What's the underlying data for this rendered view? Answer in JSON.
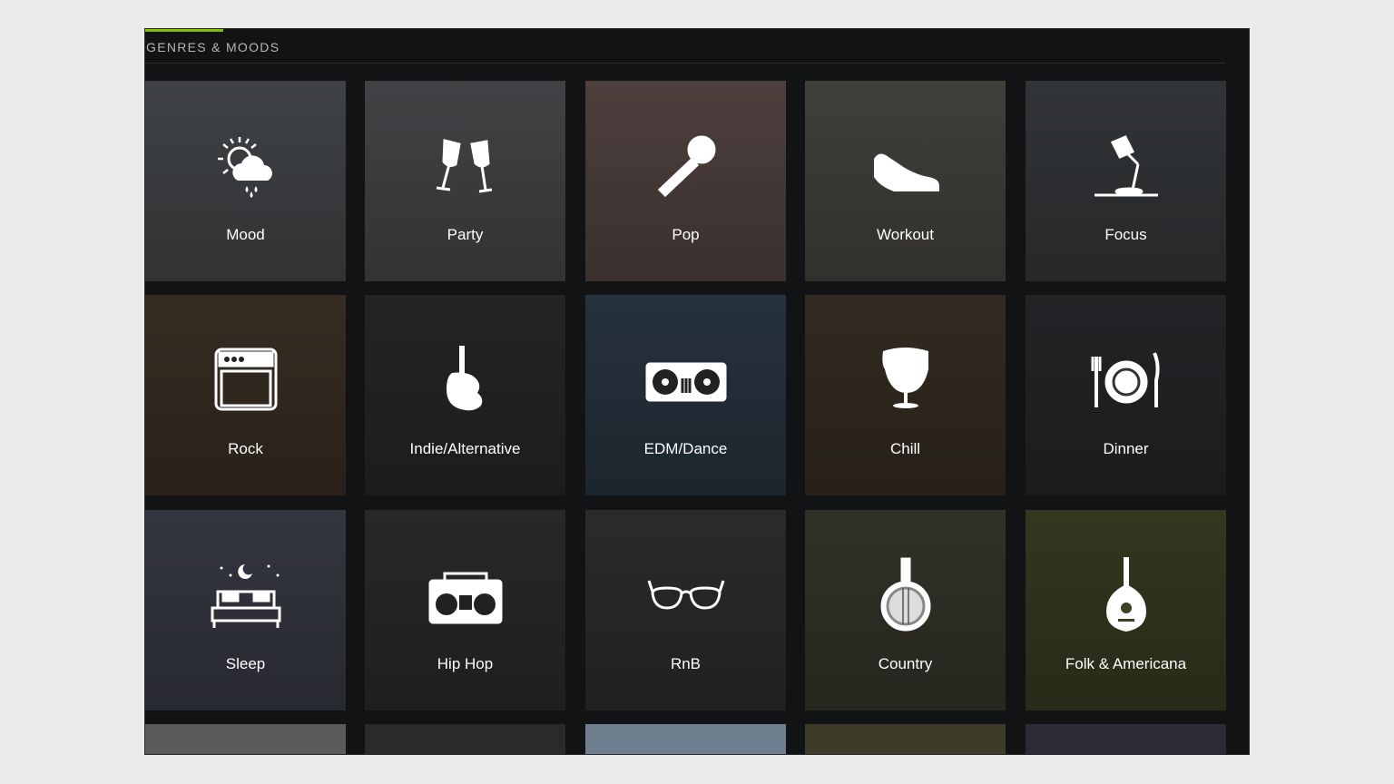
{
  "section": {
    "title": "GENRES & MOODS"
  },
  "colors": {
    "accent": "#84bd00",
    "background": "#121314",
    "title": "#b5b6b7"
  },
  "tiles": [
    {
      "label": "Mood",
      "icon": "weather-sun-cloud-rain-icon",
      "bg": "#4a4d50"
    },
    {
      "label": "Party",
      "icon": "champagne-glasses-icon",
      "bg": "#4d4e51"
    },
    {
      "label": "Pop",
      "icon": "microphone-icon",
      "bg": "#5a4a47"
    },
    {
      "label": "Workout",
      "icon": "sneaker-icon",
      "bg": "#4b4a44"
    },
    {
      "label": "Focus",
      "icon": "desk-lamp-icon",
      "bg": "#3a3d40"
    },
    {
      "label": "Rock",
      "icon": "amplifier-icon",
      "bg": "#3f3327"
    },
    {
      "label": "Indie/Alternative",
      "icon": "electric-guitar-icon",
      "bg": "#2b2b2c"
    },
    {
      "label": "EDM/Dance",
      "icon": "turntables-icon",
      "bg": "#2c3a47"
    },
    {
      "label": "Chill",
      "icon": "egg-chair-icon",
      "bg": "#3a3226"
    },
    {
      "label": "Dinner",
      "icon": "plate-fork-knife-icon",
      "bg": "#2a2a2e"
    },
    {
      "label": "Sleep",
      "icon": "bed-moon-stars-icon",
      "bg": "#3d3f4a"
    },
    {
      "label": "Hip Hop",
      "icon": "boombox-icon",
      "bg": "#2f2f30"
    },
    {
      "label": "RnB",
      "icon": "sunglasses-icon",
      "bg": "#333232"
    },
    {
      "label": "Country",
      "icon": "banjo-icon",
      "bg": "#3b3a2f"
    },
    {
      "label": "Folk & Americana",
      "icon": "mandolin-icon",
      "bg": "#3c4124"
    }
  ]
}
